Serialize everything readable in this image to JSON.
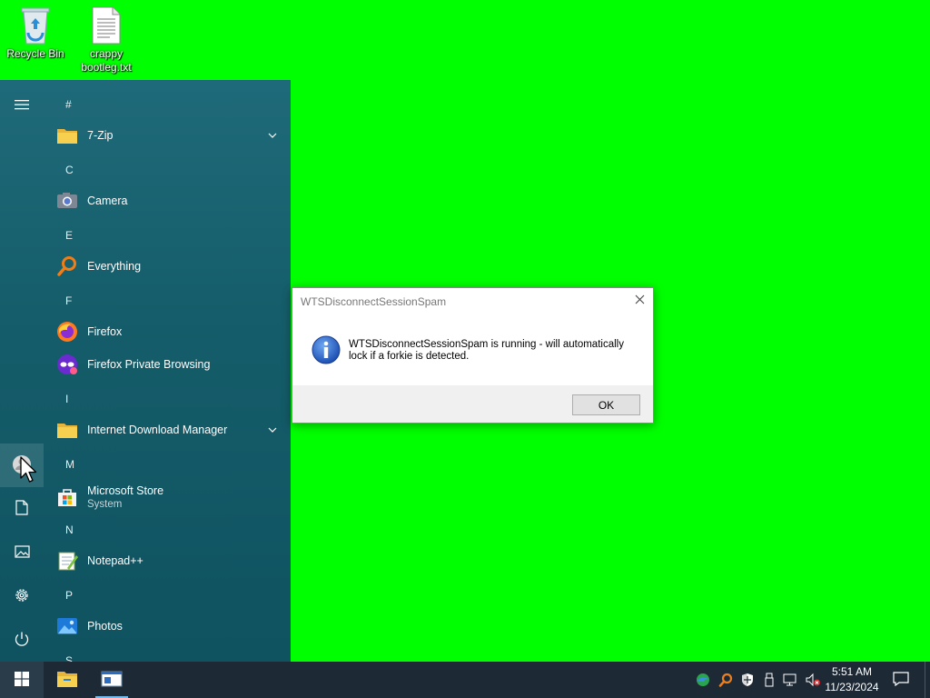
{
  "desktop": {
    "icons": [
      {
        "label": "Recycle Bin",
        "icon": "recycle-bin-icon"
      },
      {
        "label": "crappy bootleg.txt",
        "icon": "text-file-icon"
      }
    ]
  },
  "start_menu": {
    "rail": [
      {
        "name": "menu",
        "icon": "hamburger-icon"
      },
      {
        "name": "user",
        "icon": "user-icon"
      },
      {
        "name": "documents",
        "icon": "document-icon"
      },
      {
        "name": "pictures",
        "icon": "pictures-icon"
      },
      {
        "name": "settings",
        "icon": "gear-icon"
      },
      {
        "name": "power",
        "icon": "power-icon"
      }
    ],
    "letters": [
      "#",
      "C",
      "E",
      "F",
      "I",
      "M",
      "N",
      "P",
      "S"
    ],
    "apps": [
      {
        "name": "7-Zip",
        "icon": "folder-icon",
        "expandable": true
      },
      {
        "name": "Camera",
        "icon": "camera-icon"
      },
      {
        "name": "Everything",
        "icon": "magnifier-icon"
      },
      {
        "name": "Firefox",
        "icon": "firefox-icon"
      },
      {
        "name": "Firefox Private Browsing",
        "icon": "firefox-private-icon"
      },
      {
        "name": "Internet Download Manager",
        "icon": "folder-icon",
        "expandable": true
      },
      {
        "name": "Microsoft Store",
        "subtitle": "System",
        "icon": "store-icon"
      },
      {
        "name": "Notepad++",
        "icon": "notepad-plus-plus-icon"
      },
      {
        "name": "Photos",
        "icon": "photos-icon"
      }
    ]
  },
  "dialog": {
    "title": "WTSDisconnectSessionSpam",
    "message": "WTSDisconnectSessionSpam is running - will automatically lock if a forkie is detected.",
    "ok_label": "OK",
    "icon": "info-icon"
  },
  "taskbar": {
    "apps": [
      {
        "name": "file-explorer",
        "icon": "folder-icon"
      },
      {
        "name": "dialog-window",
        "icon": "window-icon",
        "running": true
      }
    ],
    "tray": [
      "edge-icon",
      "everything-icon",
      "security-icon",
      "usb-icon",
      "network-icon",
      "volume-muted-icon"
    ],
    "time": "5:51 AM",
    "date": "11/23/2024"
  },
  "colors": {
    "desktop": "#00ff00",
    "start_menu": "#155d6a",
    "taskbar": "#1d2a36",
    "accent": "#76b9ed"
  }
}
